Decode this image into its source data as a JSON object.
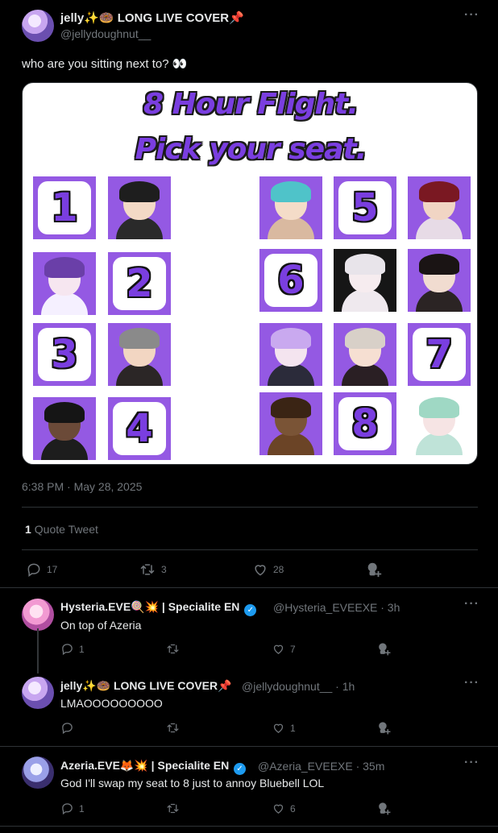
{
  "main_tweet": {
    "author_name": "jelly✨🍩 LONG LIVE COVER📌",
    "author_handle": "@jellydoughnut__",
    "text": "who are you sitting next to? 👀",
    "media": {
      "title_line1": "8 Hour Flight.",
      "title_line2": "Pick your seat.",
      "seat_numbers": [
        "1",
        "2",
        "3",
        "4",
        "5",
        "6",
        "7",
        "8"
      ]
    },
    "timestamp": "6:38 PM · May 28, 2025",
    "quote_count": "1",
    "quote_label": "Quote Tweet",
    "actions": {
      "replies": "17",
      "retweets": "3",
      "likes": "28"
    }
  },
  "replies": [
    {
      "name": "Hysteria.EVE🍭💥 | Specialite EN",
      "handle": "@Hysteria_EVEEXE · 3h",
      "text": "On top of Azeria",
      "replies": "1",
      "retweets": "",
      "likes": "7"
    },
    {
      "name": "jelly✨🍩 LONG LIVE COVER📌",
      "handle": "@jellydoughnut__ · 1h",
      "text": "LMAOOOOOOOOO",
      "replies": "",
      "retweets": "",
      "likes": "1"
    },
    {
      "name": "Azeria.EVE🦊💥 | Specialite EN",
      "handle": "@Azeria_EVEEXE · 35m",
      "text": "God I'll swap my seat to 8 just to annoy Bluebell LOL",
      "replies": "1",
      "retweets": "",
      "likes": "6"
    }
  ],
  "icons": [
    "more-icon",
    "reply-icon",
    "retweet-icon",
    "like-icon",
    "grok-icon",
    "verified-icon"
  ],
  "colors": {
    "background": "#000000",
    "muted": "#71767b",
    "text": "#e7e9ea",
    "accent_purple": "#9459e3",
    "verified_blue": "#1d9bf0"
  }
}
